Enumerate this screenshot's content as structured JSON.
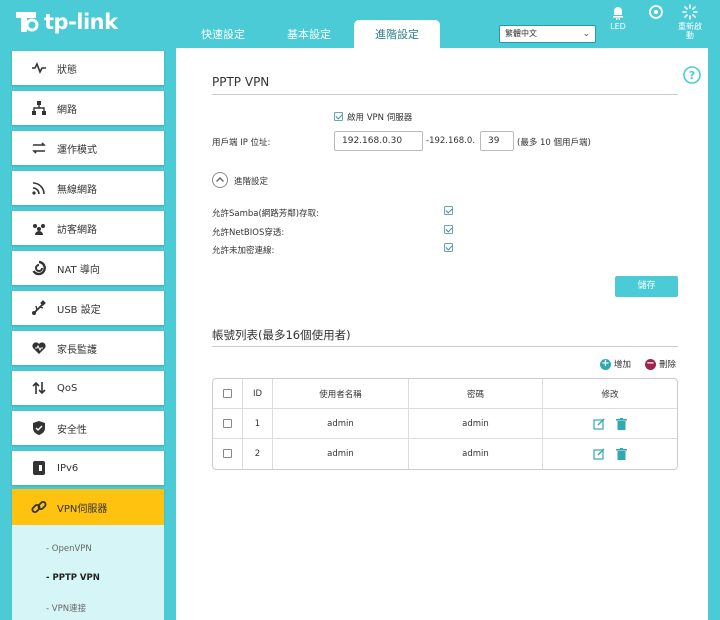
{
  "brand": "tp-link",
  "main_tabs": [
    {
      "label": "快速設定"
    },
    {
      "label": "基本設定"
    },
    {
      "label": "進階設定"
    }
  ],
  "language_select": {
    "value": "繁體中文"
  },
  "header_buttons": {
    "led": "LED",
    "reboot_line1": "重新啟",
    "reboot_line2": "動"
  },
  "sidebar": {
    "items": [
      {
        "label": "狀態",
        "icon": "pulse-icon"
      },
      {
        "label": "網路",
        "icon": "network-icon"
      },
      {
        "label": "運作模式",
        "icon": "mode-icon"
      },
      {
        "label": "無線網路",
        "icon": "wireless-icon"
      },
      {
        "label": "訪客網路",
        "icon": "guest-icon"
      },
      {
        "label": "NAT 導向",
        "icon": "nat-icon"
      },
      {
        "label": "USB 設定",
        "icon": "usb-icon"
      },
      {
        "label": "家長監護",
        "icon": "heart-icon"
      },
      {
        "label": "QoS",
        "icon": "qos-icon"
      },
      {
        "label": "安全性",
        "icon": "shield-icon"
      },
      {
        "label": "IPv6",
        "icon": "ipv6-icon"
      },
      {
        "label": "VPN伺服器",
        "icon": "vpn-icon"
      }
    ],
    "sub_items": [
      {
        "label": "- OpenVPN"
      },
      {
        "label": "- PPTP VPN"
      },
      {
        "label": "- VPN連接"
      }
    ]
  },
  "pptp": {
    "title": "PPTP VPN",
    "enable_label": "啟用 VPN 伺服器",
    "client_ip_label": "用戶端 IP 位址:",
    "ip_start": "192.168.0.30",
    "ip_mid": "-192.168.0.",
    "ip_end": "39",
    "ip_note": "(最多 10 個用戶端)",
    "advanced_label": "進階設定",
    "samba_label": "允許Samba(網路芳鄰)存取:",
    "netbios_label": "允許NetBIOS穿透:",
    "unencrypted_label": "允許未加密連線:",
    "save_label": "儲存"
  },
  "accounts": {
    "title": "帳號列表(最多16個使用者)",
    "add_label": "增加",
    "delete_label": "刪除",
    "columns": {
      "id": "ID",
      "username": "使用者名稱",
      "password": "密碼",
      "modify": "修改"
    },
    "rows": [
      {
        "id": "1",
        "username": "admin",
        "password": "admin"
      },
      {
        "id": "2",
        "username": "admin",
        "password": "admin"
      }
    ]
  },
  "colors": {
    "accent": "#4acbd6",
    "active_menu": "#ffc20e",
    "add": "#2fa9b4",
    "delete": "#a0224e"
  }
}
